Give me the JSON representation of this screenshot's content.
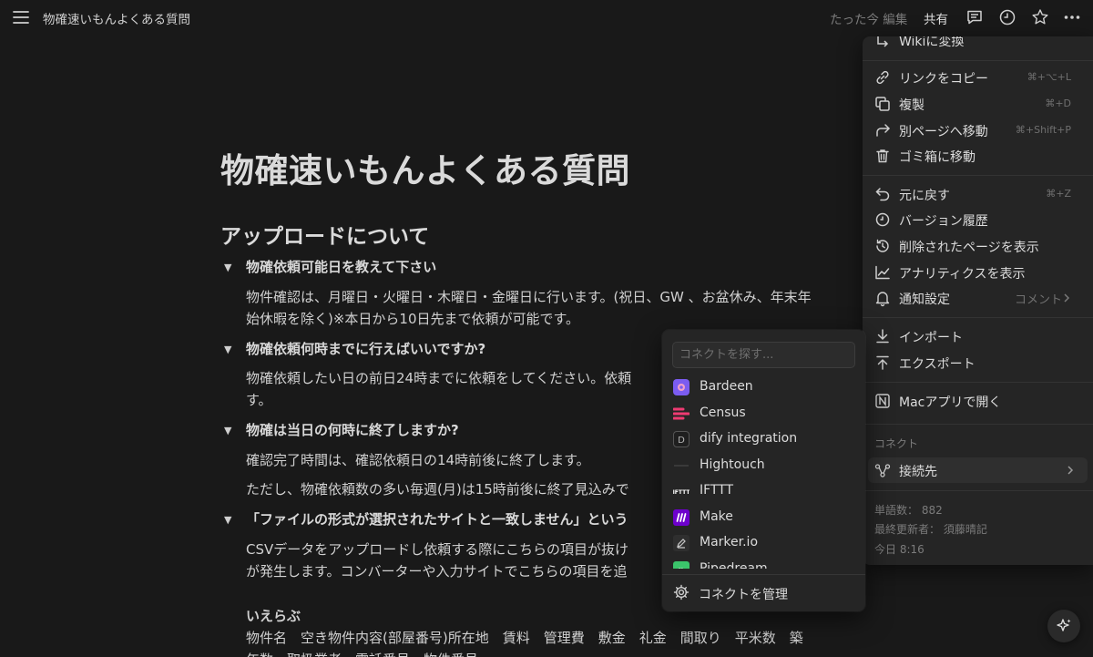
{
  "topbar": {
    "title": "物確速いもんよくある質問",
    "edited": "たった今 編集",
    "share": "共有"
  },
  "doc": {
    "title": "物確速いもんよくある質問",
    "heading": "アップロードについて",
    "q1": "物確依頼可能日を教えて下さい",
    "a1_line1": "物件確認は、月曜日・火曜日・木曜日・金曜日に行います。(祝日、GW 、お盆休み、年末年",
    "a1_line2": "始休暇を除く)※本日から10日先まで依頼が可能です。",
    "q2": "物確依頼何時までに行えばいいですか?",
    "a2_line1": "物確依頼したい日の前日24時までに依頼をしてください。依頼",
    "a2_line2": "す。",
    "q3": "物確は当日の何時に終了しますか?",
    "a3_line1": "確認完了時間は、確認依頼日の14時前後に終了します。",
    "a3_line2": "ただし、物確依頼数の多い毎週(月)は15時前後に終了見込みで",
    "q4": "「ファイルの形式が選択されたサイトと一致しません」という",
    "a4_line1": "CSVデータをアップロードし依頼する際にこちらの項目が抜け",
    "a4_line2": "が発生します。コンバーターや入力サイトでこちらの項目を追",
    "site_name": "いえらぶ",
    "fields_line1": "物件名　空き物件内容(部屋番号)所在地　賃料　管理費　敷金　礼金　間取り　平米数　築",
    "fields_line2": "年数　取扱業者　電話番号　物件番号"
  },
  "menu": {
    "top_partial": "Wikiに変換",
    "copy_link": "リンクをコピー",
    "copy_link_sc": "⌘+⌥+L",
    "duplicate": "複製",
    "duplicate_sc": "⌘+D",
    "move": "別ページへ移動",
    "move_sc": "⌘+Shift+P",
    "trash": "ゴミ箱に移動",
    "undo": "元に戻す",
    "undo_sc": "⌘+Z",
    "version": "バージョン履歴",
    "deleted": "削除されたページを表示",
    "analytics": "アナリティクスを表示",
    "notify": "通知設定",
    "notify_value": "コメント",
    "import": "インポート",
    "export": "エクスポート",
    "open_mac": "Macアプリで開く",
    "connect_section": "コネクト",
    "connections": "接続先",
    "word_count": "単語数： 882",
    "last_editor": "最終更新者： 須藤晴記",
    "updated": "今日 8:16"
  },
  "connect": {
    "search_placeholder": "コネクトを探す...",
    "items": [
      {
        "name": "Bardeen",
        "icon": "bardeen-logo",
        "color": "#7b5cf0"
      },
      {
        "name": "Census",
        "icon": "census-logo",
        "color": "#ee3b72"
      },
      {
        "name": "dify integration",
        "icon": "dify-logo",
        "color": "#9a9a9a"
      },
      {
        "name": "Hightouch",
        "icon": "hightouch-logo",
        "color": "#3a3a3a"
      },
      {
        "name": "IFTTT",
        "icon": "ifttt-logo",
        "color": "#ffffff"
      },
      {
        "name": "Make",
        "icon": "make-logo",
        "color": "#6d00cc"
      },
      {
        "name": "Marker.io",
        "icon": "marker-logo",
        "color": "#9a9a9a"
      },
      {
        "name": "Pipedream",
        "icon": "pipedream-logo",
        "color": "#3bc46b"
      }
    ],
    "manage": "コネクトを管理"
  }
}
